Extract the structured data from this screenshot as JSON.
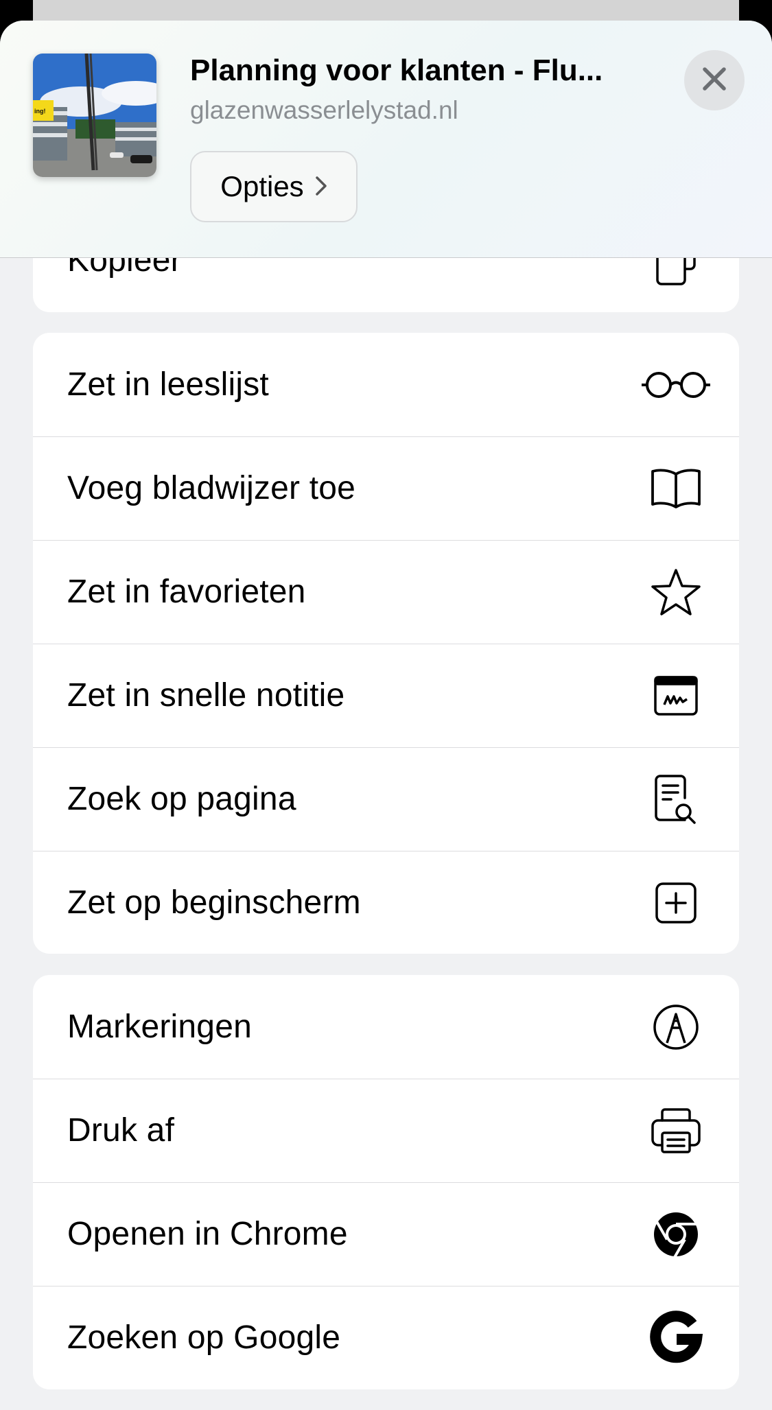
{
  "header": {
    "title": "Planning voor klanten - Flu...",
    "url": "glazenwasserlelystad.nl",
    "options_label": "Opties",
    "thumbnail_sign_text": "ing!"
  },
  "partial_row": {
    "label": "Kopieer",
    "icon": "copy-icon"
  },
  "group1": [
    {
      "label": "Zet in leeslijst",
      "icon": "glasses-icon"
    },
    {
      "label": "Voeg bladwijzer toe",
      "icon": "book-icon"
    },
    {
      "label": "Zet in favorieten",
      "icon": "star-icon"
    },
    {
      "label": "Zet in snelle notitie",
      "icon": "quick-note-icon"
    },
    {
      "label": "Zoek op pagina",
      "icon": "find-on-page-icon"
    },
    {
      "label": "Zet op beginscherm",
      "icon": "add-square-icon"
    }
  ],
  "group2": [
    {
      "label": "Markeringen",
      "icon": "markup-pen-icon"
    },
    {
      "label": "Druk af",
      "icon": "printer-icon"
    },
    {
      "label": "Openen in Chrome",
      "icon": "chrome-icon"
    },
    {
      "label": "Zoeken op Google",
      "icon": "google-icon"
    }
  ]
}
